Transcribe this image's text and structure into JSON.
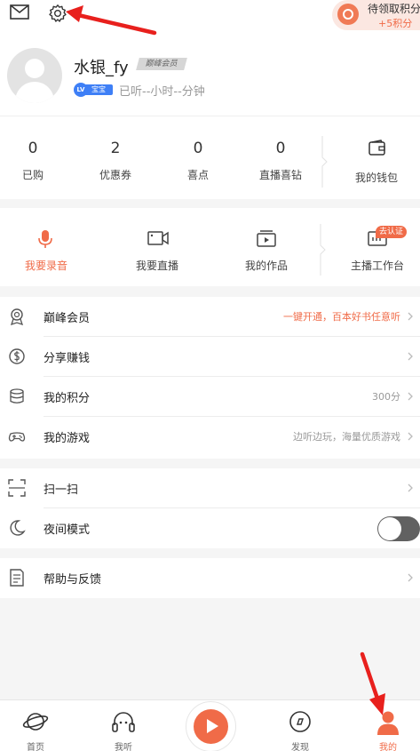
{
  "top": {
    "points_title": "待领取积分",
    "points_sub": "+5积分"
  },
  "profile": {
    "username": "水银_fy",
    "vip_tag": "巅峰会员",
    "lv_text": "LV",
    "lv_label": "宝宝",
    "listen_time": "已听--小时--分钟"
  },
  "stats": [
    {
      "num": "0",
      "label": "已购"
    },
    {
      "num": "2",
      "label": "优惠券"
    },
    {
      "num": "0",
      "label": "喜点"
    },
    {
      "num": "0",
      "label": "直播喜钻"
    }
  ],
  "wallet_label": "我的钱包",
  "tools": [
    {
      "label": "我要录音",
      "icon": "microphone-icon"
    },
    {
      "label": "我要直播",
      "icon": "video-camera-icon"
    },
    {
      "label": "我的作品",
      "icon": "my-works-icon"
    },
    {
      "label": "主播工作台",
      "icon": "anchor-workbench-icon"
    }
  ],
  "cert_badge": "去认证",
  "menu1": [
    {
      "title": "巅峰会员",
      "right": "一键开通，百本好书任意听",
      "icon": "vip-badge-icon"
    },
    {
      "title": "分享赚钱",
      "right": "",
      "icon": "share-money-icon"
    },
    {
      "title": "我的积分",
      "right": "300分",
      "icon": "points-stack-icon"
    },
    {
      "title": "我的游戏",
      "right": "边听边玩，海量优质游戏",
      "icon": "gamepad-icon"
    }
  ],
  "menu2": [
    {
      "title": "扫一扫",
      "icon": "scan-icon"
    },
    {
      "title": "夜间模式",
      "icon": "moon-icon",
      "toggle_on": false
    }
  ],
  "menu3": [
    {
      "title": "帮助与反馈",
      "icon": "help-doc-icon"
    }
  ],
  "tabbar": [
    {
      "label": "首页",
      "icon": "planet-icon"
    },
    {
      "label": "我听",
      "icon": "headphones-icon"
    },
    {
      "label": "发现",
      "icon": "compass-icon"
    },
    {
      "label": "我的",
      "icon": "person-icon",
      "active": true
    }
  ],
  "colors": {
    "accent": "#f06b48",
    "annotation_arrow": "#e8201d"
  }
}
